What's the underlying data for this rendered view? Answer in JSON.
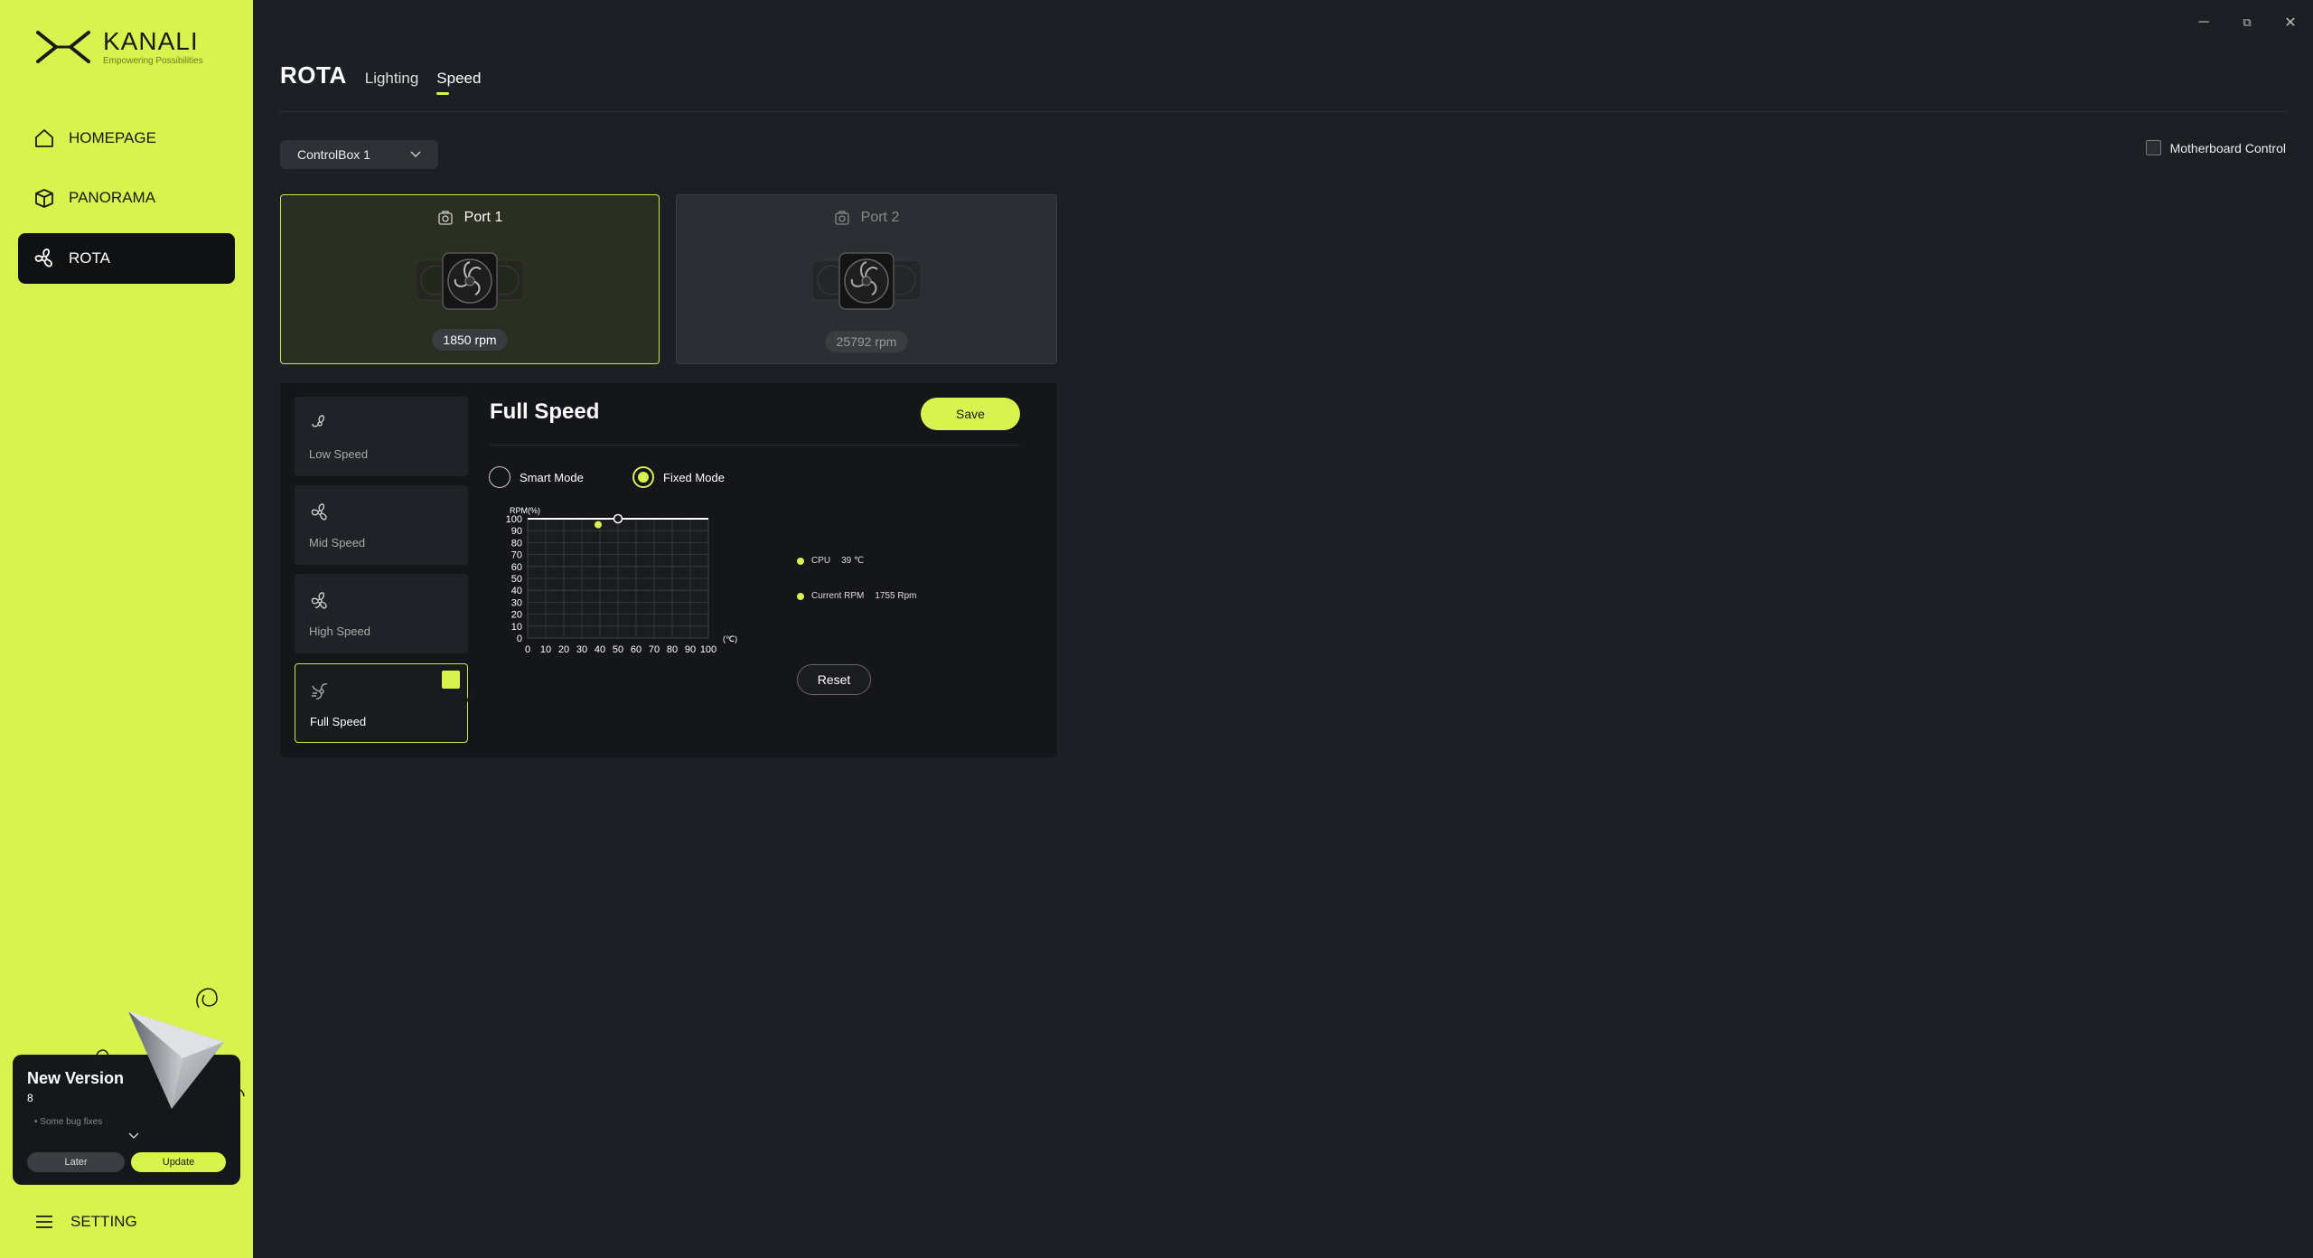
{
  "app": {
    "logo_name": "KANALI",
    "logo_tagline": "Empowering Possibilities"
  },
  "sidebar": {
    "items": [
      {
        "label": "HOMEPAGE",
        "icon": "home-icon"
      },
      {
        "label": "PANORAMA",
        "icon": "box-icon"
      },
      {
        "label": "ROTA",
        "icon": "fan-icon",
        "active": true
      }
    ],
    "setting_label": "SETTING"
  },
  "update_card": {
    "title": "New Version",
    "version": "8",
    "note": "• Some bug fixes",
    "later_label": "Later",
    "update_label": "Update"
  },
  "window_controls": {
    "minimize": "─",
    "restore": "⧉",
    "close": "✕"
  },
  "header": {
    "title": "ROTA",
    "tabs": [
      {
        "label": "Lighting",
        "active": false
      },
      {
        "label": "Speed",
        "active": true
      }
    ]
  },
  "controller": {
    "selected": "ControlBox 1"
  },
  "motherboard_control": {
    "label": "Motherboard Control",
    "checked": false
  },
  "ports": [
    {
      "label": "Port 1",
      "rpm": "1850 rpm",
      "active": true
    },
    {
      "label": "Port 2",
      "rpm": "25792 rpm",
      "active": false
    }
  ],
  "presets": [
    {
      "label": "Low Speed",
      "active": false
    },
    {
      "label": "Mid Speed",
      "active": false
    },
    {
      "label": "High Speed",
      "active": false
    },
    {
      "label": "Full Speed",
      "active": true
    }
  ],
  "speed_panel": {
    "title": "Full Speed",
    "save_label": "Save",
    "reset_label": "Reset",
    "modes": [
      {
        "label": "Smart Mode",
        "selected": false
      },
      {
        "label": "Fixed Mode",
        "selected": true
      }
    ],
    "legend": [
      {
        "label": "CPU",
        "value": "39 ℃"
      },
      {
        "label": "Current RPM",
        "value": "1755 Rpm"
      }
    ]
  },
  "colors": {
    "accent": "#d8f24e",
    "background": "#1c1f23",
    "panel": "#141619"
  },
  "chart_data": {
    "type": "line",
    "ylabel": "RPM(%)",
    "xlabel": "(℃)",
    "x_ticks": [
      0,
      10,
      20,
      30,
      40,
      50,
      60,
      70,
      80,
      90,
      100
    ],
    "y_ticks": [
      0,
      10,
      20,
      30,
      40,
      50,
      60,
      70,
      80,
      90,
      100
    ],
    "xlim": [
      0,
      100
    ],
    "ylim": [
      0,
      100
    ],
    "grid": true,
    "series": [
      {
        "x": [
          0,
          50,
          100
        ],
        "y": [
          100,
          100,
          100
        ]
      }
    ],
    "control_point": {
      "x": 50,
      "y": 100
    },
    "current_point": {
      "x": 39,
      "y": 95
    }
  }
}
